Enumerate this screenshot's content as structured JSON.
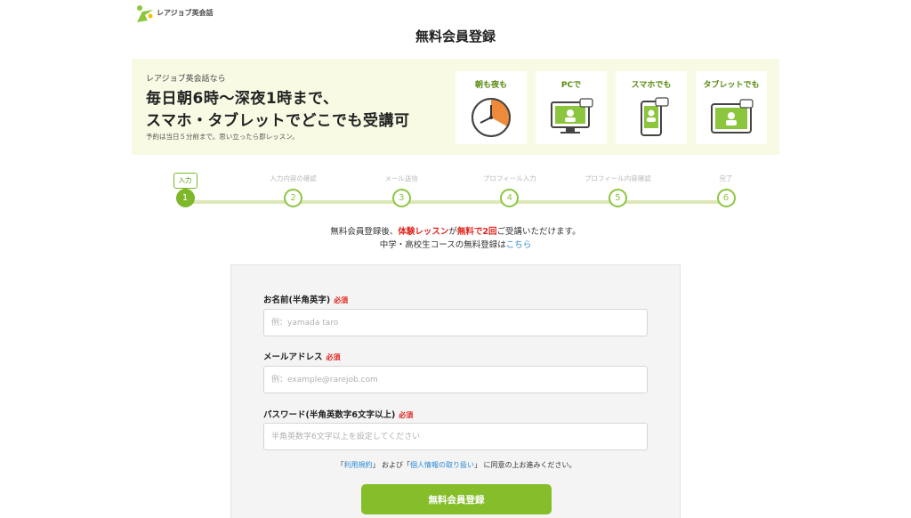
{
  "brand": {
    "name": "レアジョブ英会話",
    "accent": "#86bd2b",
    "error": "#e1241b",
    "link": "#2a8bd6"
  },
  "page": {
    "title": "無料会員登録"
  },
  "banner": {
    "intro": "レアジョブ英会話なら",
    "headline1": "毎日朝6時〜深夜1時まで、",
    "headline2": "スマホ・タブレットでどこでも受講可",
    "note": "予約は当日５分前まで。思い立ったら即レッスン。",
    "features": [
      {
        "label": "朝も夜も",
        "icon": "clock-icon"
      },
      {
        "label": "PCで",
        "icon": "pc-icon"
      },
      {
        "label": "スマホでも",
        "icon": "smartphone-icon"
      },
      {
        "label": "タブレットでも",
        "icon": "tablet-icon"
      }
    ]
  },
  "stepper": {
    "current_tag": "入力",
    "steps": [
      {
        "num": "1",
        "label": ""
      },
      {
        "num": "2",
        "label": "入力内容の確認"
      },
      {
        "num": "3",
        "label": "メール送信"
      },
      {
        "num": "4",
        "label": "プロフィール入力"
      },
      {
        "num": "5",
        "label": "プロフィール内容確認"
      },
      {
        "num": "6",
        "label": "完了"
      }
    ]
  },
  "intro": {
    "line1_a": "無料会員登録後、",
    "line1_b": "体験レッスン",
    "line1_c": "が",
    "line1_d": "無料で2回",
    "line1_e": "ご受講いただけます。",
    "line2_a": "中学・高校生コースの無料登録は",
    "line2_link": "こちら"
  },
  "form": {
    "required": "必須",
    "name": {
      "label": "お名前(半角英字)",
      "placeholder": "例：yamada taro",
      "value": ""
    },
    "email": {
      "label": "メールアドレス",
      "placeholder": "例：example@rarejob.com",
      "value": ""
    },
    "password": {
      "label": "パスワード(半角英数字6文字以上)",
      "placeholder": "半角英数字6文字以上を設定してください",
      "value": ""
    },
    "terms_a": "「",
    "terms_link1": "利用規約",
    "terms_b": "」 および「",
    "terms_link2": "個人情報の取り扱い",
    "terms_c": "」 に同意の上お進みください。",
    "submit": "無料会員登録"
  }
}
